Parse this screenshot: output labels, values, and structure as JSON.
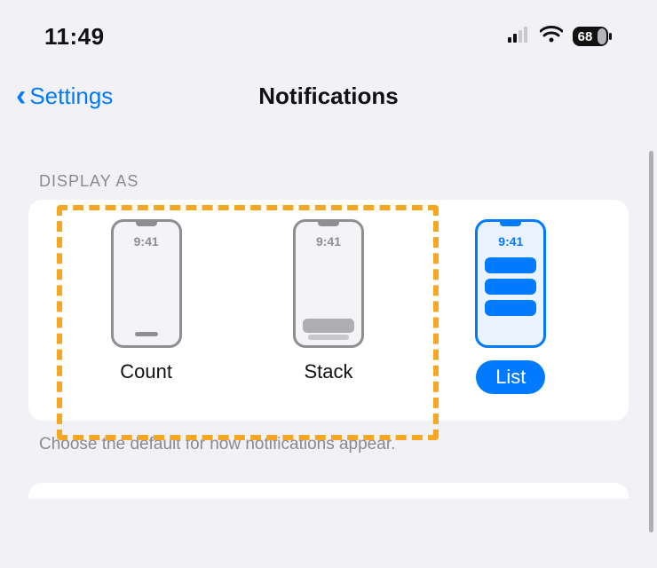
{
  "status": {
    "time": "11:49",
    "battery": "68"
  },
  "nav": {
    "back_label": "Settings",
    "title": "Notifications"
  },
  "section": {
    "header": "DISPLAY AS",
    "phone_time": "9:41",
    "options": {
      "count": "Count",
      "stack": "Stack",
      "list": "List"
    },
    "footer": "Choose the default for how notifications appear."
  }
}
